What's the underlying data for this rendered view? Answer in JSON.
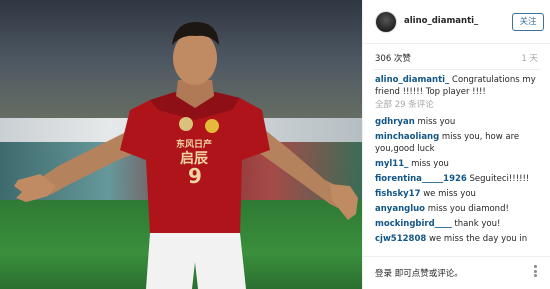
{
  "post": {
    "username": "alino_diamanti_",
    "follow_label": "关注",
    "likes_text": "306 次赞",
    "time_text": "1 天",
    "caption_user": "alino_diamanti_",
    "caption_text": "Congratulations my friend !!!!!! Top player !!!!",
    "more_comments": "全部 29 条评论",
    "jersey": {
      "sponsor": "东风日产",
      "sponsor2": "启辰",
      "number": "9"
    }
  },
  "comments": [
    {
      "user": "gdhryan",
      "text": "miss you"
    },
    {
      "user": "minchaoliang",
      "text": "miss you, how are you,good luck"
    },
    {
      "user": "myl11_",
      "text": "miss you"
    },
    {
      "user": "fiorentina_____1926",
      "text": "Seguiteci!!!!!!"
    },
    {
      "user": "fishsky17",
      "text": "we miss you"
    },
    {
      "user": "anyangluo",
      "text": "miss you diamond!"
    },
    {
      "user": "mockingbird____",
      "text": "thank you!"
    },
    {
      "user": "cjw512808",
      "text": "we miss the day you in"
    }
  ],
  "footer": {
    "login_text": "登录 即可点赞或评论。"
  },
  "colors": {
    "link": "#125688",
    "follow": "#3f729b",
    "jersey_red": "#b0141b"
  }
}
